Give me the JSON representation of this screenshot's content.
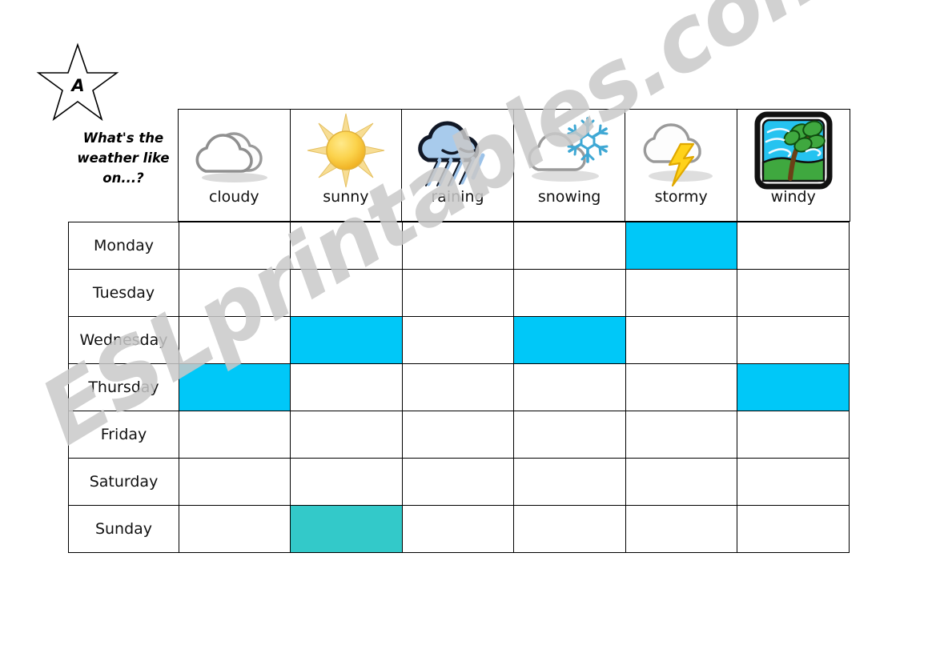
{
  "worksheet": {
    "badge_letter": "A",
    "prompt": "What's the weather like on...?",
    "watermark": "ESLprintables.com"
  },
  "colors": {
    "highlight_cyan": "#00c8f8",
    "highlight_teal": "#33c9c9",
    "grid_line": "#000000",
    "watermark": "#c9c9c9"
  },
  "table": {
    "columns": [
      {
        "label": "cloudy",
        "icon": "cloudy-icon"
      },
      {
        "label": "sunny",
        "icon": "sunny-icon"
      },
      {
        "label": "raining",
        "icon": "raining-icon"
      },
      {
        "label": "snowing",
        "icon": "snowing-icon"
      },
      {
        "label": "stormy",
        "icon": "stormy-icon"
      },
      {
        "label": "windy",
        "icon": "windy-icon"
      }
    ],
    "rows": [
      {
        "day": "Monday",
        "cells": [
          "",
          "",
          "",
          "",
          "cyan",
          ""
        ]
      },
      {
        "day": "Tuesday",
        "cells": [
          "",
          "",
          "",
          "",
          "",
          ""
        ]
      },
      {
        "day": "Wednesday",
        "cells": [
          "",
          "cyan",
          "",
          "cyan",
          "",
          ""
        ]
      },
      {
        "day": "Thursday",
        "cells": [
          "cyan",
          "",
          "",
          "",
          "",
          "cyan"
        ]
      },
      {
        "day": "Friday",
        "cells": [
          "",
          "",
          "",
          "",
          "",
          ""
        ]
      },
      {
        "day": "Saturday",
        "cells": [
          "",
          "",
          "",
          "",
          "",
          ""
        ]
      },
      {
        "day": "Sunday",
        "cells": [
          "",
          "teal",
          "",
          "",
          "",
          ""
        ]
      }
    ]
  }
}
